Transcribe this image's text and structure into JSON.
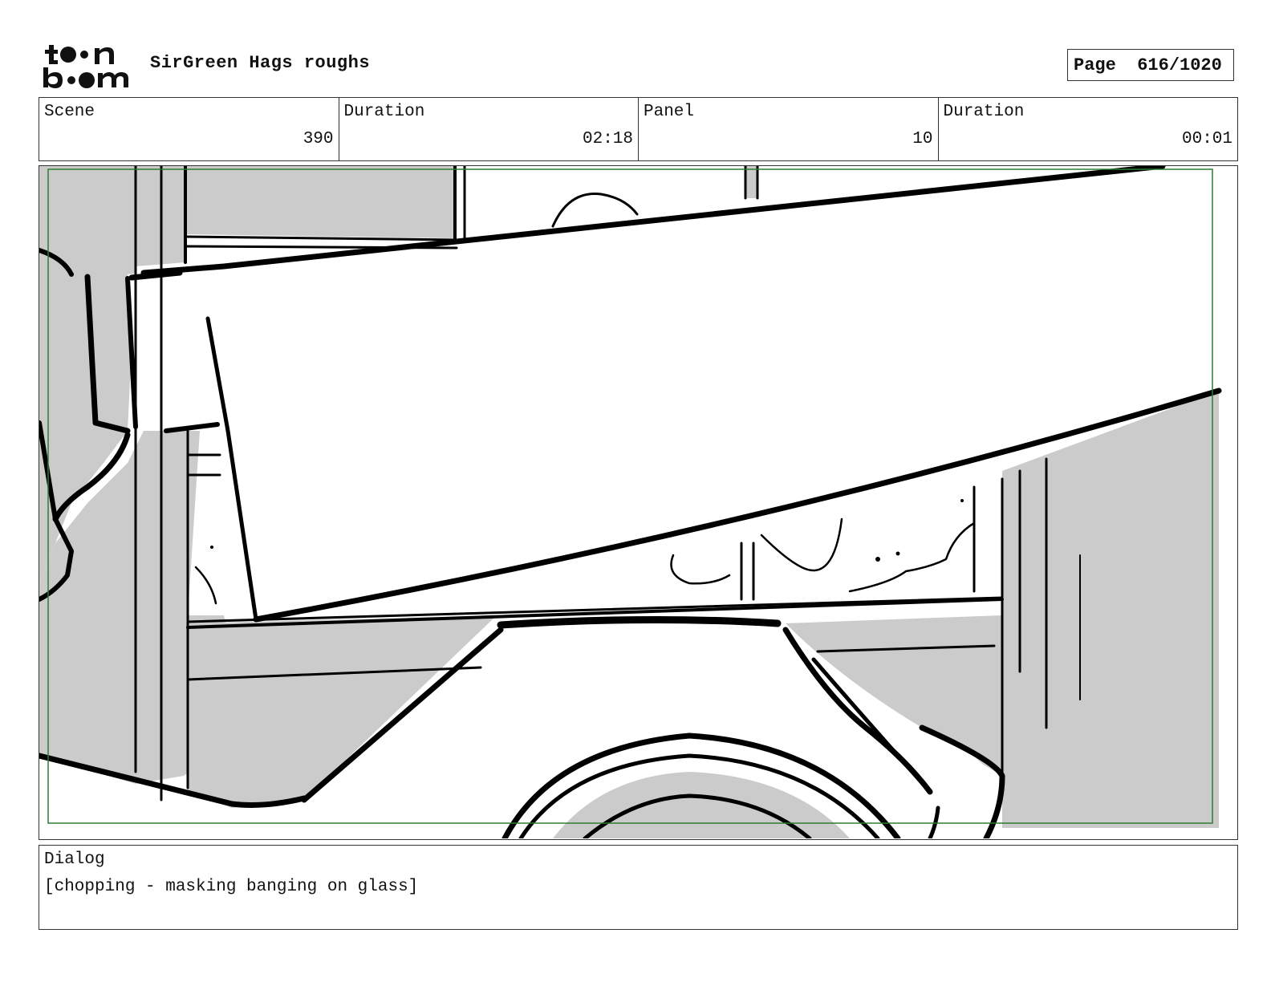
{
  "header": {
    "logo_text": "toon boom",
    "project_title": "SirGreen Hags roughs",
    "page_label": "Page",
    "page_number": "616/1020"
  },
  "info": {
    "scene_label": "Scene",
    "scene_value": "390",
    "scene_duration_label": "Duration",
    "scene_duration_value": "02:18",
    "panel_label": "Panel",
    "panel_value": "10",
    "panel_duration_label": "Duration",
    "panel_duration_value": "00:01"
  },
  "panel_image": {
    "icon": "storyboard-sketch",
    "safe_frame_color": "#2e7d32",
    "fill_color": "#cbcbcb",
    "line_color": "#000000"
  },
  "dialog": {
    "label": "Dialog",
    "text": "[chopping - masking banging on glass]"
  }
}
